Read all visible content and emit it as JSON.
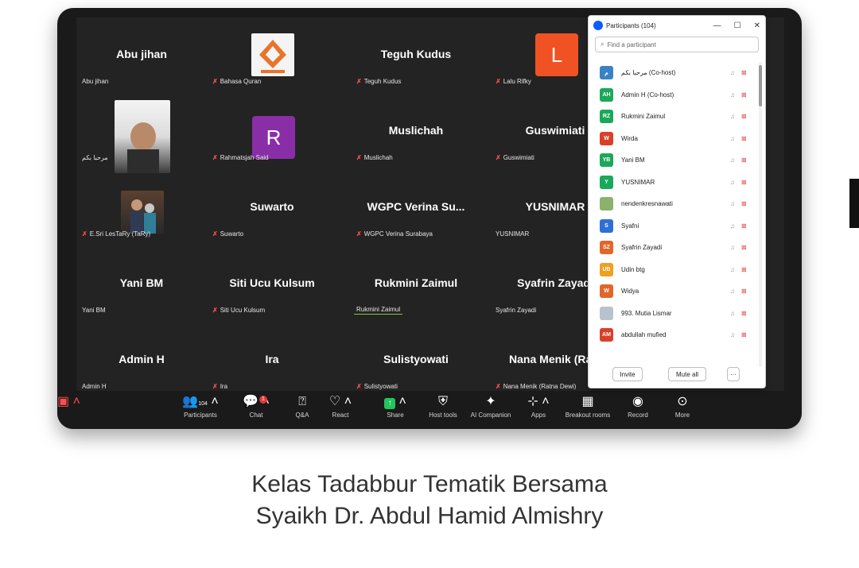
{
  "caption": {
    "line1": "Kelas Tadabbur Tematik Bersama",
    "line2": "Syaikh Dr. Abdul Hamid Almishry"
  },
  "tiles": [
    {
      "big": "Abu jihan",
      "small": "Abu jihan",
      "muted": false
    },
    {
      "big": "",
      "small": "Bahasa Quran",
      "muted": true
    },
    {
      "big": "Teguh Kudus",
      "small": "Teguh Kudus",
      "muted": true
    },
    {
      "big": "",
      "small": "Lalu Rifky",
      "muted": true,
      "avatar": "L"
    },
    {
      "big": "",
      "small": "مرحبا بكم",
      "muted": false
    },
    {
      "big": "",
      "small": "Rahmatsjah Said",
      "muted": true,
      "avatar": "R"
    },
    {
      "big": "Muslichah",
      "small": "Muslichah",
      "muted": true
    },
    {
      "big": "Guswimiati",
      "small": "Guswimiati",
      "muted": true
    },
    {
      "big": "",
      "small": "E.Sri LesTaRy (TaRy)",
      "muted": true
    },
    {
      "big": "Suwarto",
      "small": "Suwarto",
      "muted": true
    },
    {
      "big": "WGPC Verina Su...",
      "small": "WGPC Verina Surabaya",
      "muted": true
    },
    {
      "big": "YUSNIMAR",
      "small": "YUSNIMAR",
      "muted": false
    },
    {
      "big": "Yani BM",
      "small": "Yani BM",
      "muted": false
    },
    {
      "big": "Siti Ucu Kulsum",
      "small": "Siti Ucu Kulsum",
      "muted": true
    },
    {
      "big": "Rukmini Zaimul",
      "small": "Rukmini Zaimul",
      "muted": false
    },
    {
      "big": "Syafrin Zayadi",
      "small": "Syafrin Zayadi",
      "muted": false
    },
    {
      "big": "Admin H",
      "small": "Admin H",
      "muted": false
    },
    {
      "big": "Ira",
      "small": "Ira",
      "muted": true
    },
    {
      "big": "Sulistyowati",
      "small": "Sulistyowati",
      "muted": true
    },
    {
      "big": "Nana Menik (Ra...",
      "small": "Nana Menik (Ratna Dewi)",
      "muted": true
    }
  ],
  "toolbar": {
    "participants": "Participants",
    "participants_count": "104",
    "chat": "Chat",
    "chat_badge": "1",
    "qa": "Q&A",
    "react": "React",
    "share": "Share",
    "host_tools": "Host tools",
    "ai_companion": "AI Companion",
    "apps": "Apps",
    "breakout": "Breakout rooms",
    "record": "Record",
    "more": "More"
  },
  "panel": {
    "title": "Participants (104)",
    "search_placeholder": "Find a participant",
    "invite": "Invite",
    "mute_all": "Mute all",
    "more": "···",
    "participants": [
      {
        "initials": "م",
        "name": "مرحبا بكم (Co-host)",
        "color": "#3b82c4"
      },
      {
        "initials": "AH",
        "name": "Admin H (Co-host)",
        "color": "#1aa85a"
      },
      {
        "initials": "RZ",
        "name": "Rukmini Zaimul",
        "color": "#1aa85a"
      },
      {
        "initials": "W",
        "name": "Wirda",
        "color": "#d9402b"
      },
      {
        "initials": "YB",
        "name": "Yani BM",
        "color": "#1aa85a"
      },
      {
        "initials": "Y",
        "name": "YUSNIMAR",
        "color": "#1aa85a"
      },
      {
        "initials": "",
        "name": "nendenkresnawati",
        "color": "#8bb26b"
      },
      {
        "initials": "S",
        "name": "Syafni",
        "color": "#2f6fd6"
      },
      {
        "initials": "SZ",
        "name": "Syafrin Zayadi",
        "color": "#e0662a"
      },
      {
        "initials": "UB",
        "name": "Udin btg",
        "color": "#f0a020"
      },
      {
        "initials": "W",
        "name": "Widya",
        "color": "#e0662a"
      },
      {
        "initials": "",
        "name": "993. Mutia Lismar",
        "color": "#b8c2cc"
      },
      {
        "initials": "AM",
        "name": "abdullah mufied",
        "color": "#d9402b"
      }
    ]
  },
  "colors": {
    "accent": "#1e7fd6",
    "screen": "#232323"
  }
}
